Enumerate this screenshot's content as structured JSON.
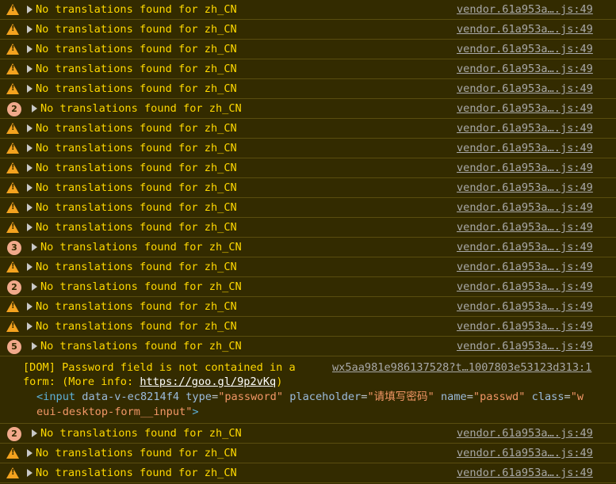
{
  "colors": {
    "background": "#332b00",
    "warning_text": "#ffd900",
    "warning_icon": "#f4a31f",
    "count_badge": "#f1a98b",
    "source_link": "#a8a8a8"
  },
  "messages_before": [
    {
      "type": "warning",
      "icon": "warning-icon",
      "text": "No translations found for zh_CN",
      "source": "vendor.61a953a….js:49"
    },
    {
      "type": "warning",
      "icon": "warning-icon",
      "text": "No translations found for zh_CN",
      "source": "vendor.61a953a….js:49"
    },
    {
      "type": "warning",
      "icon": "warning-icon",
      "text": "No translations found for zh_CN",
      "source": "vendor.61a953a….js:49"
    },
    {
      "type": "warning",
      "icon": "warning-icon",
      "text": "No translations found for zh_CN",
      "source": "vendor.61a953a….js:49"
    },
    {
      "type": "warning",
      "icon": "warning-icon",
      "text": "No translations found for zh_CN",
      "source": "vendor.61a953a….js:49"
    },
    {
      "type": "count",
      "count": "2",
      "text": "No translations found for zh_CN",
      "source": "vendor.61a953a….js:49"
    },
    {
      "type": "warning",
      "icon": "warning-icon",
      "text": "No translations found for zh_CN",
      "source": "vendor.61a953a….js:49"
    },
    {
      "type": "warning",
      "icon": "warning-icon",
      "text": "No translations found for zh_CN",
      "source": "vendor.61a953a….js:49"
    },
    {
      "type": "warning",
      "icon": "warning-icon",
      "text": "No translations found for zh_CN",
      "source": "vendor.61a953a….js:49"
    },
    {
      "type": "warning",
      "icon": "warning-icon",
      "text": "No translations found for zh_CN",
      "source": "vendor.61a953a….js:49"
    },
    {
      "type": "warning",
      "icon": "warning-icon",
      "text": "No translations found for zh_CN",
      "source": "vendor.61a953a….js:49"
    },
    {
      "type": "warning",
      "icon": "warning-icon",
      "text": "No translations found for zh_CN",
      "source": "vendor.61a953a….js:49"
    },
    {
      "type": "count",
      "count": "3",
      "text": "No translations found for zh_CN",
      "source": "vendor.61a953a….js:49"
    },
    {
      "type": "warning",
      "icon": "warning-icon",
      "text": "No translations found for zh_CN",
      "source": "vendor.61a953a….js:49"
    },
    {
      "type": "count",
      "count": "2",
      "text": "No translations found for zh_CN",
      "source": "vendor.61a953a….js:49"
    },
    {
      "type": "warning",
      "icon": "warning-icon",
      "text": "No translations found for zh_CN",
      "source": "vendor.61a953a….js:49"
    },
    {
      "type": "warning",
      "icon": "warning-icon",
      "text": "No translations found for zh_CN",
      "source": "vendor.61a953a….js:49"
    },
    {
      "type": "count",
      "count": "5",
      "text": "No translations found for zh_CN",
      "source": "vendor.61a953a….js:49"
    }
  ],
  "dom_message": {
    "line1": "[DOM] Password field is not contained in a",
    "line2_prefix": "form: (More info: ",
    "link": "https://goo.gl/9p2vKq",
    "line2_suffix": ")",
    "source": "wx5aa981e986137528?t…1007803e53123d313:1",
    "element": {
      "open": "<input",
      "attr1_name": "data-v-ec8214f4",
      "attr2_name": "type",
      "attr2_value": "\"password\"",
      "attr3_name": "placeholder",
      "attr3_value": "\"请填写密码\"",
      "attr4_name": "name",
      "attr4_value": "\"passwd\"",
      "attr5_name": "class",
      "attr5_value_start": "\"w",
      "attr5_value_end": "eui-desktop-form__input\"",
      "close": ">"
    }
  },
  "messages_after": [
    {
      "type": "count",
      "count": "2",
      "text": "No translations found for zh_CN",
      "source": "vendor.61a953a….js:49"
    },
    {
      "type": "warning",
      "icon": "warning-icon",
      "text": "No translations found for zh_CN",
      "source": "vendor.61a953a….js:49"
    },
    {
      "type": "warning",
      "icon": "warning-icon",
      "text": "No translations found for zh_CN",
      "source": "vendor.61a953a….js:49"
    }
  ]
}
